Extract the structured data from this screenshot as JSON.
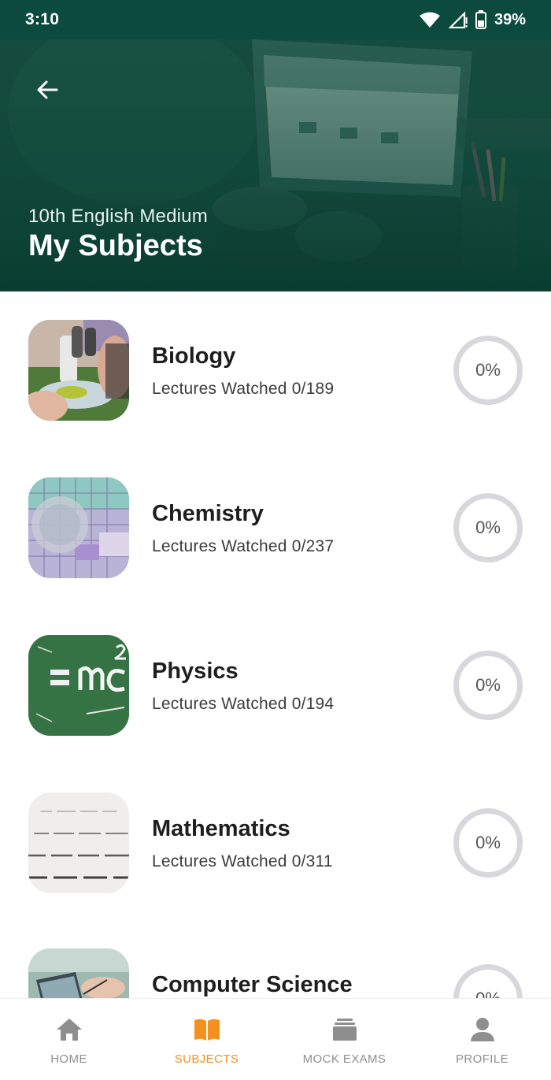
{
  "status_bar": {
    "time": "3:10",
    "battery": "39%"
  },
  "header": {
    "subtitle": "10th English Medium",
    "title": "My Subjects",
    "back_icon": "arrow-back-icon"
  },
  "subjects": [
    {
      "name": "Biology",
      "lectures": "Lectures Watched 0/189",
      "progress": "0%"
    },
    {
      "name": "Chemistry",
      "lectures": "Lectures Watched 0/237",
      "progress": "0%"
    },
    {
      "name": "Physics",
      "lectures": "Lectures Watched 0/194",
      "progress": "0%"
    },
    {
      "name": "Mathematics",
      "lectures": "Lectures Watched 0/311",
      "progress": "0%"
    },
    {
      "name": "Computer Science",
      "lectures": "",
      "progress": "0%"
    }
  ],
  "bottom_nav": {
    "active": "SUBJECTS",
    "items": [
      {
        "label": "HOME",
        "icon": "home-icon"
      },
      {
        "label": "SUBJECTS",
        "icon": "book-icon"
      },
      {
        "label": "MOCK EXAMS",
        "icon": "stack-icon"
      },
      {
        "label": "PROFILE",
        "icon": "person-icon"
      }
    ]
  },
  "colors": {
    "status_bar": "#0b4a3c",
    "accent": "#f5901e",
    "inactive": "#8e8e8e",
    "ring": "#d8d8dc"
  }
}
